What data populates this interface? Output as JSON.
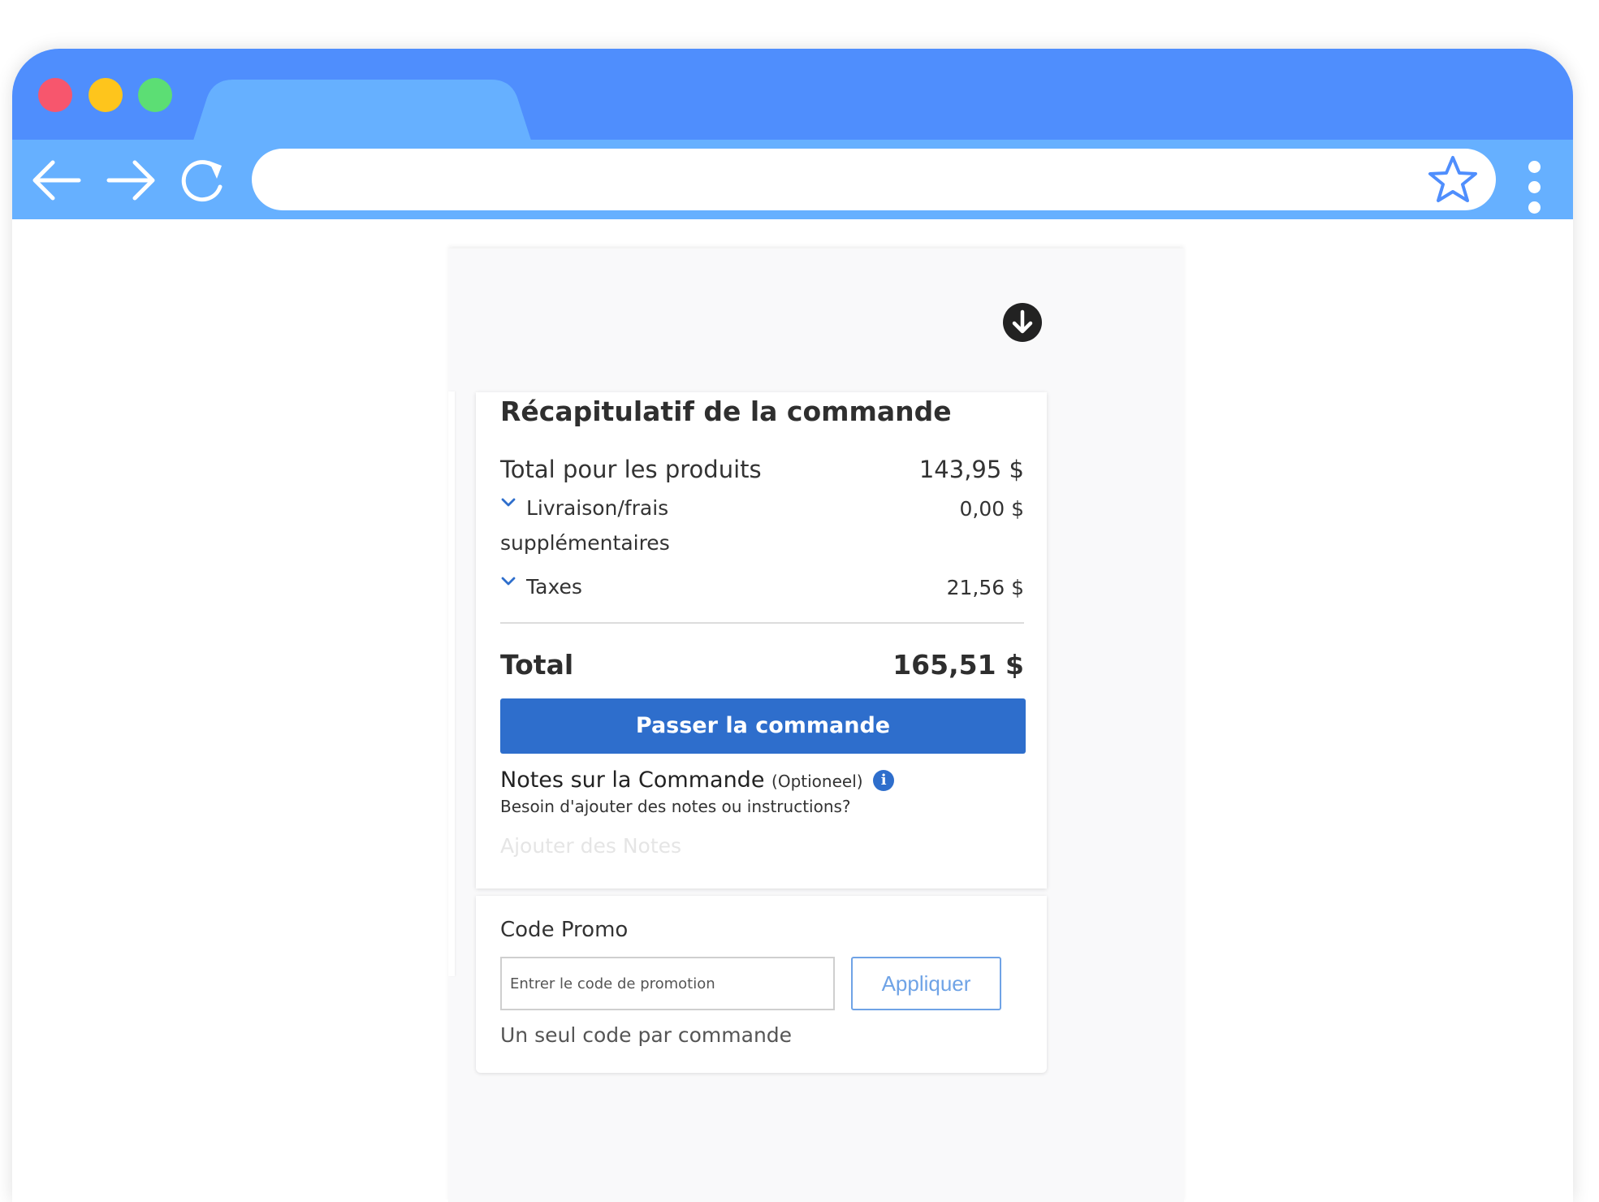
{
  "browser": {
    "address": {
      "value": ""
    }
  },
  "summary": {
    "title": "Récapitulatif de la commande",
    "products_label": "Total pour les produits",
    "products_value": "143,95 $",
    "shipping_label_1": "Livraison/frais",
    "shipping_label_2": "supplémentaires",
    "shipping_value": "0,00 $",
    "taxes_label": "Taxes",
    "taxes_value": "21,56 $",
    "total_label": "Total",
    "total_value": "165,51 $",
    "place_order_label": "Passer la commande",
    "notes_title": "Notes sur la Commande",
    "notes_optional": "(Optioneel)",
    "notes_info_glyph": "i",
    "notes_subtitle": "Besoin d'ajouter des notes ou instructions?",
    "notes_placeholder": "Ajouter des Notes"
  },
  "promo": {
    "title": "Code Promo",
    "input_placeholder": "Entrer le code de promotion",
    "apply_label": "Appliquer",
    "note": "Un seul code par commande"
  },
  "colors": {
    "tabbar": "#4f8efd",
    "toolbar": "#66b0ff",
    "primary_button": "#2e6ecc",
    "apply_button": "#6fa3e6"
  },
  "icons": [
    "back-arrow-icon",
    "forward-arrow-icon",
    "reload-icon",
    "bookmark-star-icon",
    "menu-dots-icon",
    "download-icon",
    "chevron-down-icon",
    "info-icon"
  ]
}
